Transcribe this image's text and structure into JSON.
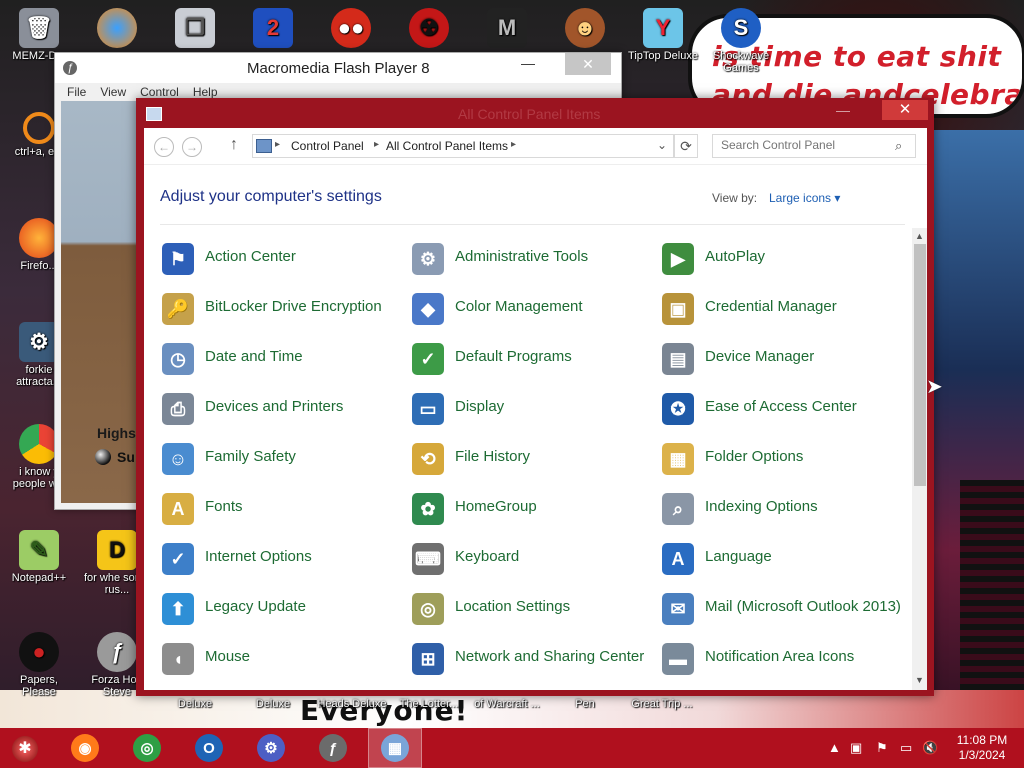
{
  "wallpaper": {
    "speech_line1": "is time to eat shit",
    "speech_line2": "and die andcelebrate",
    "bottom_banner": "Everyone!"
  },
  "desktop_icons": [
    {
      "label": "MEMZ-D..."
    },
    {
      "label": "ctrl+a, e..."
    },
    {
      "label": "Firefo..."
    },
    {
      "label": "forkie attracta..."
    },
    {
      "label": "i know y people w..."
    },
    {
      "label": "Notepad++"
    },
    {
      "label": "for whe some rus..."
    },
    {
      "label": "Papers, Please"
    },
    {
      "label": "Forza Hori Steve"
    },
    {
      "label": "TipTop Deluxe"
    },
    {
      "label": "Shockwave Games"
    },
    {
      "label": "e"
    }
  ],
  "desktop_bottom_labels": [
    "Deluxe",
    "Deluxe",
    "Heads Deluxe",
    "The Lotter...",
    "of Warcraft ...",
    "Pen",
    "Great Trip ..."
  ],
  "flash_window": {
    "title": "Macromedia Flash Player 8",
    "menu": [
      "File",
      "View",
      "Control",
      "Help"
    ],
    "stage_text1": "Highs",
    "stage_text2": "Su",
    "close": "✕",
    "minimize": "—",
    "maximize": "☐"
  },
  "control_panel": {
    "title": "All Control Panel Items",
    "breadcrumb": [
      "Control Panel",
      "All Control Panel Items"
    ],
    "search_placeholder": "Search Control Panel",
    "heading": "Adjust your computer's settings",
    "view_by_label": "View by:",
    "view_by_value": "Large icons ▾",
    "close": "✕",
    "minimize": "—",
    "maximize": "☐",
    "items": [
      {
        "label": "Action Center",
        "icon": "flag-icon",
        "color": "#2d5fb8",
        "glyph": "⚑"
      },
      {
        "label": "Administrative Tools",
        "icon": "admin-tools-icon",
        "color": "#8a9bb3",
        "glyph": "⚙"
      },
      {
        "label": "AutoPlay",
        "icon": "autoplay-icon",
        "color": "#3f8d3f",
        "glyph": "▶"
      },
      {
        "label": "BitLocker Drive Encryption",
        "icon": "bitlocker-icon",
        "color": "#c5a14a",
        "glyph": "🔑"
      },
      {
        "label": "Color Management",
        "icon": "color-management-icon",
        "color": "#4a78c8",
        "glyph": "◆"
      },
      {
        "label": "Credential Manager",
        "icon": "credential-manager-icon",
        "color": "#b8933a",
        "glyph": "▣"
      },
      {
        "label": "Date and Time",
        "icon": "clock-icon",
        "color": "#6a8fc0",
        "glyph": "◷"
      },
      {
        "label": "Default Programs",
        "icon": "default-programs-icon",
        "color": "#3d9b47",
        "glyph": "✓"
      },
      {
        "label": "Device Manager",
        "icon": "device-manager-icon",
        "color": "#7a8593",
        "glyph": "▤"
      },
      {
        "label": "Devices and Printers",
        "icon": "printer-icon",
        "color": "#7b8797",
        "glyph": "⎙"
      },
      {
        "label": "Display",
        "icon": "display-icon",
        "color": "#2e6db5",
        "glyph": "▭"
      },
      {
        "label": "Ease of Access Center",
        "icon": "ease-of-access-icon",
        "color": "#1f5aa8",
        "glyph": "✪"
      },
      {
        "label": "Family Safety",
        "icon": "family-safety-icon",
        "color": "#4a8cd0",
        "glyph": "☺"
      },
      {
        "label": "File History",
        "icon": "file-history-icon",
        "color": "#d6a83a",
        "glyph": "⟲"
      },
      {
        "label": "Folder Options",
        "icon": "folder-options-icon",
        "color": "#dcb24a",
        "glyph": "▦"
      },
      {
        "label": "Fonts",
        "icon": "fonts-icon",
        "color": "#d8ae43",
        "glyph": "A"
      },
      {
        "label": "HomeGroup",
        "icon": "homegroup-icon",
        "color": "#2f8a4f",
        "glyph": "✿"
      },
      {
        "label": "Indexing Options",
        "icon": "indexing-options-icon",
        "color": "#8a96a6",
        "glyph": "⌕"
      },
      {
        "label": "Internet Options",
        "icon": "internet-options-icon",
        "color": "#3d7fc9",
        "glyph": "✓"
      },
      {
        "label": "Keyboard",
        "icon": "keyboard-icon",
        "color": "#6f6f6f",
        "glyph": "⌨"
      },
      {
        "label": "Language",
        "icon": "language-icon",
        "color": "#2a6cc2",
        "glyph": "A"
      },
      {
        "label": "Legacy Update",
        "icon": "legacy-update-icon",
        "color": "#2e8fd6",
        "glyph": "⬆"
      },
      {
        "label": "Location Settings",
        "icon": "location-settings-icon",
        "color": "#9e9e5a",
        "glyph": "◎"
      },
      {
        "label": "Mail (Microsoft Outlook 2013)",
        "icon": "mail-icon",
        "color": "#4a7fbf",
        "glyph": "✉"
      },
      {
        "label": "Mouse",
        "icon": "mouse-icon",
        "color": "#8d8d8d",
        "glyph": "◖"
      },
      {
        "label": "Network and Sharing Center",
        "icon": "network-sharing-icon",
        "color": "#2f5fa8",
        "glyph": "⊞"
      },
      {
        "label": "Notification Area Icons",
        "icon": "notification-area-icon",
        "color": "#7a8a9a",
        "glyph": "▬"
      }
    ]
  },
  "taskbar": {
    "items": [
      {
        "name": "firefox-taskbar-button",
        "icon": "firefox-icon",
        "color": "#ff7a1a",
        "glyph": "◉",
        "active": false
      },
      {
        "name": "chrome-taskbar-button",
        "icon": "chrome-icon",
        "color": "#2f9e44",
        "glyph": "◎",
        "active": false
      },
      {
        "name": "outlook-taskbar-button",
        "icon": "outlook-icon",
        "color": "#1f64b5",
        "glyph": "O",
        "active": false
      },
      {
        "name": "settings-taskbar-button",
        "icon": "settings-gear-icon",
        "color": "#4d5fc4",
        "glyph": "⚙",
        "active": false
      },
      {
        "name": "flash-player-taskbar-button",
        "icon": "flash-icon",
        "color": "#6b6b6b",
        "glyph": "ƒ",
        "active": false
      },
      {
        "name": "control-panel-taskbar-button",
        "icon": "control-panel-icon",
        "color": "#7aa5d8",
        "glyph": "▦",
        "active": true
      }
    ],
    "time": "11:08 PM",
    "date": "1/3/2024"
  }
}
